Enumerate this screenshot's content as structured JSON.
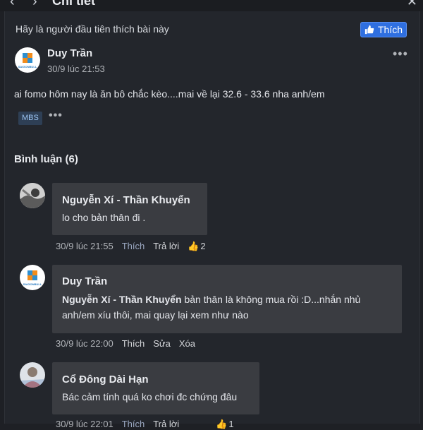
{
  "window": {
    "title": "Chi tiết"
  },
  "post": {
    "like_prompt": "Hãy là người đầu tiên thích bài này",
    "like_button": "Thích",
    "author": "Duy Trần",
    "time": "30/9 lúc 21:53",
    "text": "ai fomo hôm nay là ăn bô chắc kèo....mai về lại 32.6 - 33.6 nha anh/em",
    "tag": "MBS",
    "avatar_text": "SAIGONBULL"
  },
  "comments_header": "Bình luận (6)",
  "comments": [
    {
      "author": "Nguyễn Xí - Thần Khuyển",
      "text": "lo cho bản thân đi .",
      "time": "30/9 lúc 21:55",
      "actions": [
        "Thích",
        "Trả lời"
      ],
      "reactions": "2"
    },
    {
      "author": "Duy Trần",
      "mention": "Nguyễn Xí - Thần Khuyển",
      "text_line1": " bản thân là không mua rồi :D...nhắn nhủ",
      "text_line2": "anh/em xíu thôi, mai quay lại xem như nào",
      "time": "30/9 lúc 22:00",
      "actions": [
        "Thích",
        "Sửa",
        "Xóa"
      ]
    },
    {
      "author": "Cổ Đông Dài Hạn",
      "text": "Bác cảm tính quá ko chơi đc chứng đâu",
      "time": "30/9 lúc 22:01",
      "actions": [
        "Thích",
        "Trả lời"
      ],
      "reactions": "1"
    }
  ]
}
